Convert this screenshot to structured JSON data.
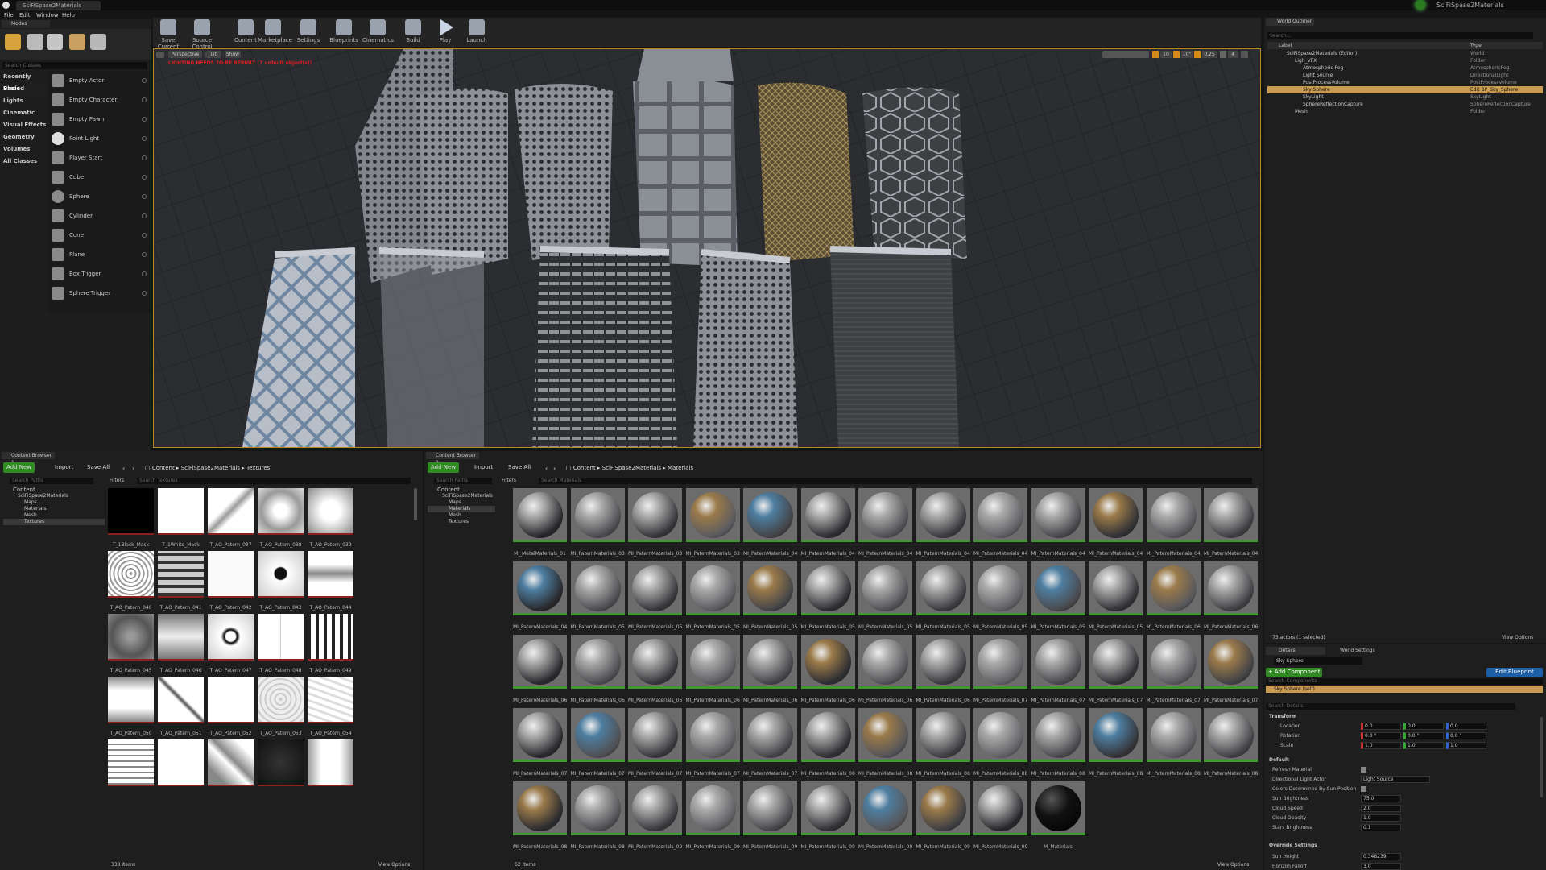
{
  "window": {
    "title": "SciFiSpase2Materials",
    "tab": "SciFiSpase2Materials",
    "project_badge": "SciFiSpase2Materials"
  },
  "menu": [
    "File",
    "Edit",
    "Window",
    "Help"
  ],
  "modes": {
    "title": "Modes",
    "search_placeholder": "Search Classes",
    "categories": [
      "Recently Placed",
      "Basic",
      "Lights",
      "Cinematic",
      "Visual Effects",
      "Geometry",
      "Volumes",
      "All Classes"
    ],
    "selected_category": "Basic",
    "items": [
      "Empty Actor",
      "Empty Character",
      "Empty Pawn",
      "Point Light",
      "Player Start",
      "Cube",
      "Sphere",
      "Cylinder",
      "Cone",
      "Plane",
      "Box Trigger",
      "Sphere Trigger"
    ]
  },
  "toolbar": {
    "buttons": [
      {
        "label": "Save Current",
        "icon": "save-icon"
      },
      {
        "label": "Source Control",
        "icon": "source-control-icon"
      },
      {
        "label": "Content",
        "icon": "content-icon"
      },
      {
        "label": "Marketplace",
        "icon": "marketplace-icon"
      },
      {
        "label": "Settings",
        "icon": "settings-icon"
      },
      {
        "label": "Blueprints",
        "icon": "blueprints-icon"
      },
      {
        "label": "Cinematics",
        "icon": "cinematics-icon"
      },
      {
        "label": "Build",
        "icon": "build-icon"
      },
      {
        "label": "Play",
        "icon": "play-icon"
      },
      {
        "label": "Launch",
        "icon": "launch-icon"
      }
    ]
  },
  "viewport": {
    "perspective": "Perspective",
    "lit": "Lit",
    "show": "Show",
    "warning": "LIGHTING NEEDS TO BE REBUILT (7 unbuilt object(s))",
    "snap_values": [
      "10",
      "10°",
      "0.25",
      "4"
    ]
  },
  "outliner": {
    "title": "World Outliner",
    "search_placeholder": "Search...",
    "col_label": "Label",
    "col_type": "Type",
    "rows": [
      {
        "label": "SciFiSpase2Materials (Editor)",
        "type": "World",
        "indent": 0,
        "selected": false
      },
      {
        "label": "Ligh_VFX",
        "type": "Folder",
        "indent": 1,
        "selected": false
      },
      {
        "label": "Atmospheric Fog",
        "type": "AtmosphericFog",
        "indent": 2,
        "selected": false
      },
      {
        "label": "Light Source",
        "type": "DirectionalLight",
        "indent": 2,
        "selected": false
      },
      {
        "label": "PostProcessVolume",
        "type": "PostProcessVolume",
        "indent": 2,
        "selected": false
      },
      {
        "label": "Sky Sphere",
        "type": "Edit BP_Sky_Sphere",
        "indent": 2,
        "selected": true
      },
      {
        "label": "SkyLight",
        "type": "SkyLight",
        "indent": 2,
        "selected": false
      },
      {
        "label": "SphereReflectionCapture",
        "type": "SphereReflectionCapture",
        "indent": 2,
        "selected": false
      },
      {
        "label": "Mesh",
        "type": "Folder",
        "indent": 1,
        "selected": false
      }
    ],
    "status": "73 actors (1 selected)",
    "view_options": "View Options"
  },
  "details": {
    "tab_details": "Details",
    "tab_world_settings": "World Settings",
    "name_value": "Sky Sphere",
    "add_component": "+ Add Component",
    "edit_blueprint": "Edit Blueprint",
    "search_components": "Search Components",
    "component_self": "Sky Sphere (self)",
    "search_details": "Search Details",
    "transform_header": "Transform",
    "location": "Location",
    "rotation": "Rotation",
    "scale": "Scale",
    "loc_vals": [
      "0.0",
      "0.0",
      "0.0"
    ],
    "rot_vals": [
      "0.0 °",
      "0.0 °",
      "0.0 °"
    ],
    "scale_vals": [
      "1.0",
      "1.0",
      "1.0"
    ],
    "default_header": "Default",
    "props": [
      {
        "name": "Refresh Material",
        "value": "",
        "kind": "check"
      },
      {
        "name": "Directional Light Actor",
        "value": "Light Source",
        "kind": "dropdown"
      },
      {
        "name": "Colors Determined By Sun Position",
        "value": "",
        "kind": "check"
      },
      {
        "name": "Sun Brightness",
        "value": "75.0",
        "kind": "num"
      },
      {
        "name": "Cloud Speed",
        "value": "2.0",
        "kind": "num"
      },
      {
        "name": "Cloud Opacity",
        "value": "1.0",
        "kind": "num"
      },
      {
        "name": "Stars Brightness",
        "value": "0.1",
        "kind": "num"
      }
    ],
    "override_header": "Override Settings",
    "override_props": [
      {
        "name": "Sun Height",
        "value": "0.348239"
      },
      {
        "name": "Horizon Falloff",
        "value": "3.0"
      }
    ]
  },
  "cb1": {
    "tab": "Content Browser 1",
    "add_new": "Add New",
    "import": "Import",
    "save_all": "Save All",
    "breadcrumb": [
      "Content",
      "SciFiSpase2Materials",
      "Textures"
    ],
    "search_paths": "Search Paths",
    "filters": "Filters",
    "search_assets": "Search Textures",
    "tree": [
      "Content",
      "SciFiSpase2Materials",
      "Maps",
      "Materials",
      "Mesh",
      "Textures"
    ],
    "assets": [
      "T_1Black_Mask",
      "T_1White_Mask",
      "T_AO_Patern_037",
      "T_AO_Patern_038",
      "T_AO_Patern_039",
      "T_AO_Patern_040",
      "T_AO_Patern_041",
      "T_AO_Patern_042",
      "T_AO_Patern_043",
      "T_AO_Patern_044",
      "T_AO_Patern_045",
      "T_AO_Patern_046",
      "T_AO_Patern_047",
      "T_AO_Patern_048",
      "T_AO_Patern_049",
      "T_AO_Patern_050",
      "T_AO_Patern_051",
      "T_AO_Patern_052",
      "T_AO_Patern_053",
      "T_AO_Patern_054",
      "",
      "",
      "",
      "",
      ""
    ],
    "count": "338 items",
    "view_options": "View Options"
  },
  "cb2": {
    "tab": "Content Browser 2",
    "add_new": "Add New",
    "import": "Import",
    "save_all": "Save All",
    "breadcrumb": [
      "Content",
      "SciFiSpase2Materials",
      "Materials"
    ],
    "search_paths": "Search Paths",
    "filters": "Filters",
    "search_assets": "Search Materials",
    "tree": [
      "Content",
      "SciFiSpase2Materials",
      "Maps",
      "Materials",
      "Mesh",
      "Textures"
    ],
    "assets": [
      "MI_MetalMaterials_01",
      "MI_PaternMaterials_037",
      "MI_PaternMaterials_038",
      "MI_PaternMaterials_039",
      "MI_PaternMaterials_040",
      "MI_PaternMaterials_041",
      "MI_PaternMaterials_042",
      "MI_PaternMaterials_043",
      "MI_PaternMaterials_044",
      "MI_PaternMaterials_045",
      "MI_PaternMaterials_046",
      "MI_PaternMaterials_047",
      "MI_PaternMaterials_048",
      "MI_PaternMaterials_049",
      "MI_PaternMaterials_050",
      "MI_PaternMaterials_051",
      "MI_PaternMaterials_052",
      "MI_PaternMaterials_053",
      "MI_PaternMaterials_054",
      "MI_PaternMaterials_055",
      "MI_PaternMaterials_056",
      "MI_PaternMaterials_057",
      "MI_PaternMaterials_058",
      "MI_PaternMaterials_059",
      "MI_PaternMaterials_060",
      "MI_PaternMaterials_061",
      "MI_PaternMaterials_062",
      "MI_PaternMaterials_063",
      "MI_PaternMaterials_064",
      "MI_PaternMaterials_065",
      "MI_PaternMaterials_066",
      "MI_PaternMaterials_067",
      "MI_PaternMaterials_068",
      "MI_PaternMaterials_069",
      "MI_PaternMaterials_070",
      "MI_PaternMaterials_071",
      "MI_PaternMaterials_072",
      "MI_PaternMaterials_073",
      "MI_PaternMaterials_074",
      "MI_PaternMaterials_075",
      "MI_PaternMaterials_076",
      "MI_PaternMaterials_077",
      "MI_PaternMaterials_078",
      "MI_PaternMaterials_079",
      "MI_PaternMaterials_080",
      "MI_PaternMaterials_081",
      "MI_PaternMaterials_082",
      "MI_PaternMaterials_083",
      "MI_PaternMaterials_084",
      "MI_PaternMaterials_085",
      "MI_PaternMaterials_086",
      "MI_PaternMaterials_087",
      "MI_PaternMaterials_088",
      "MI_PaternMaterials_089",
      "MI_PaternMaterials_090",
      "MI_PaternMaterials_091",
      "MI_PaternMaterials_092",
      "MI_PaternMaterials_093",
      "MI_PaternMaterials_094",
      "MI_PaternMaterials_095",
      "MI_PaternMaterials_096",
      "M_Materials"
    ],
    "count": "62 items",
    "view_options": "View Options"
  },
  "colors": {
    "accent": "#3fa22e",
    "selection": "#c99a53",
    "warning": "#e02020",
    "viewport_border": "#b88a1e",
    "add_new": "#2f8a22",
    "edit_bp": "#1b5fa8"
  }
}
